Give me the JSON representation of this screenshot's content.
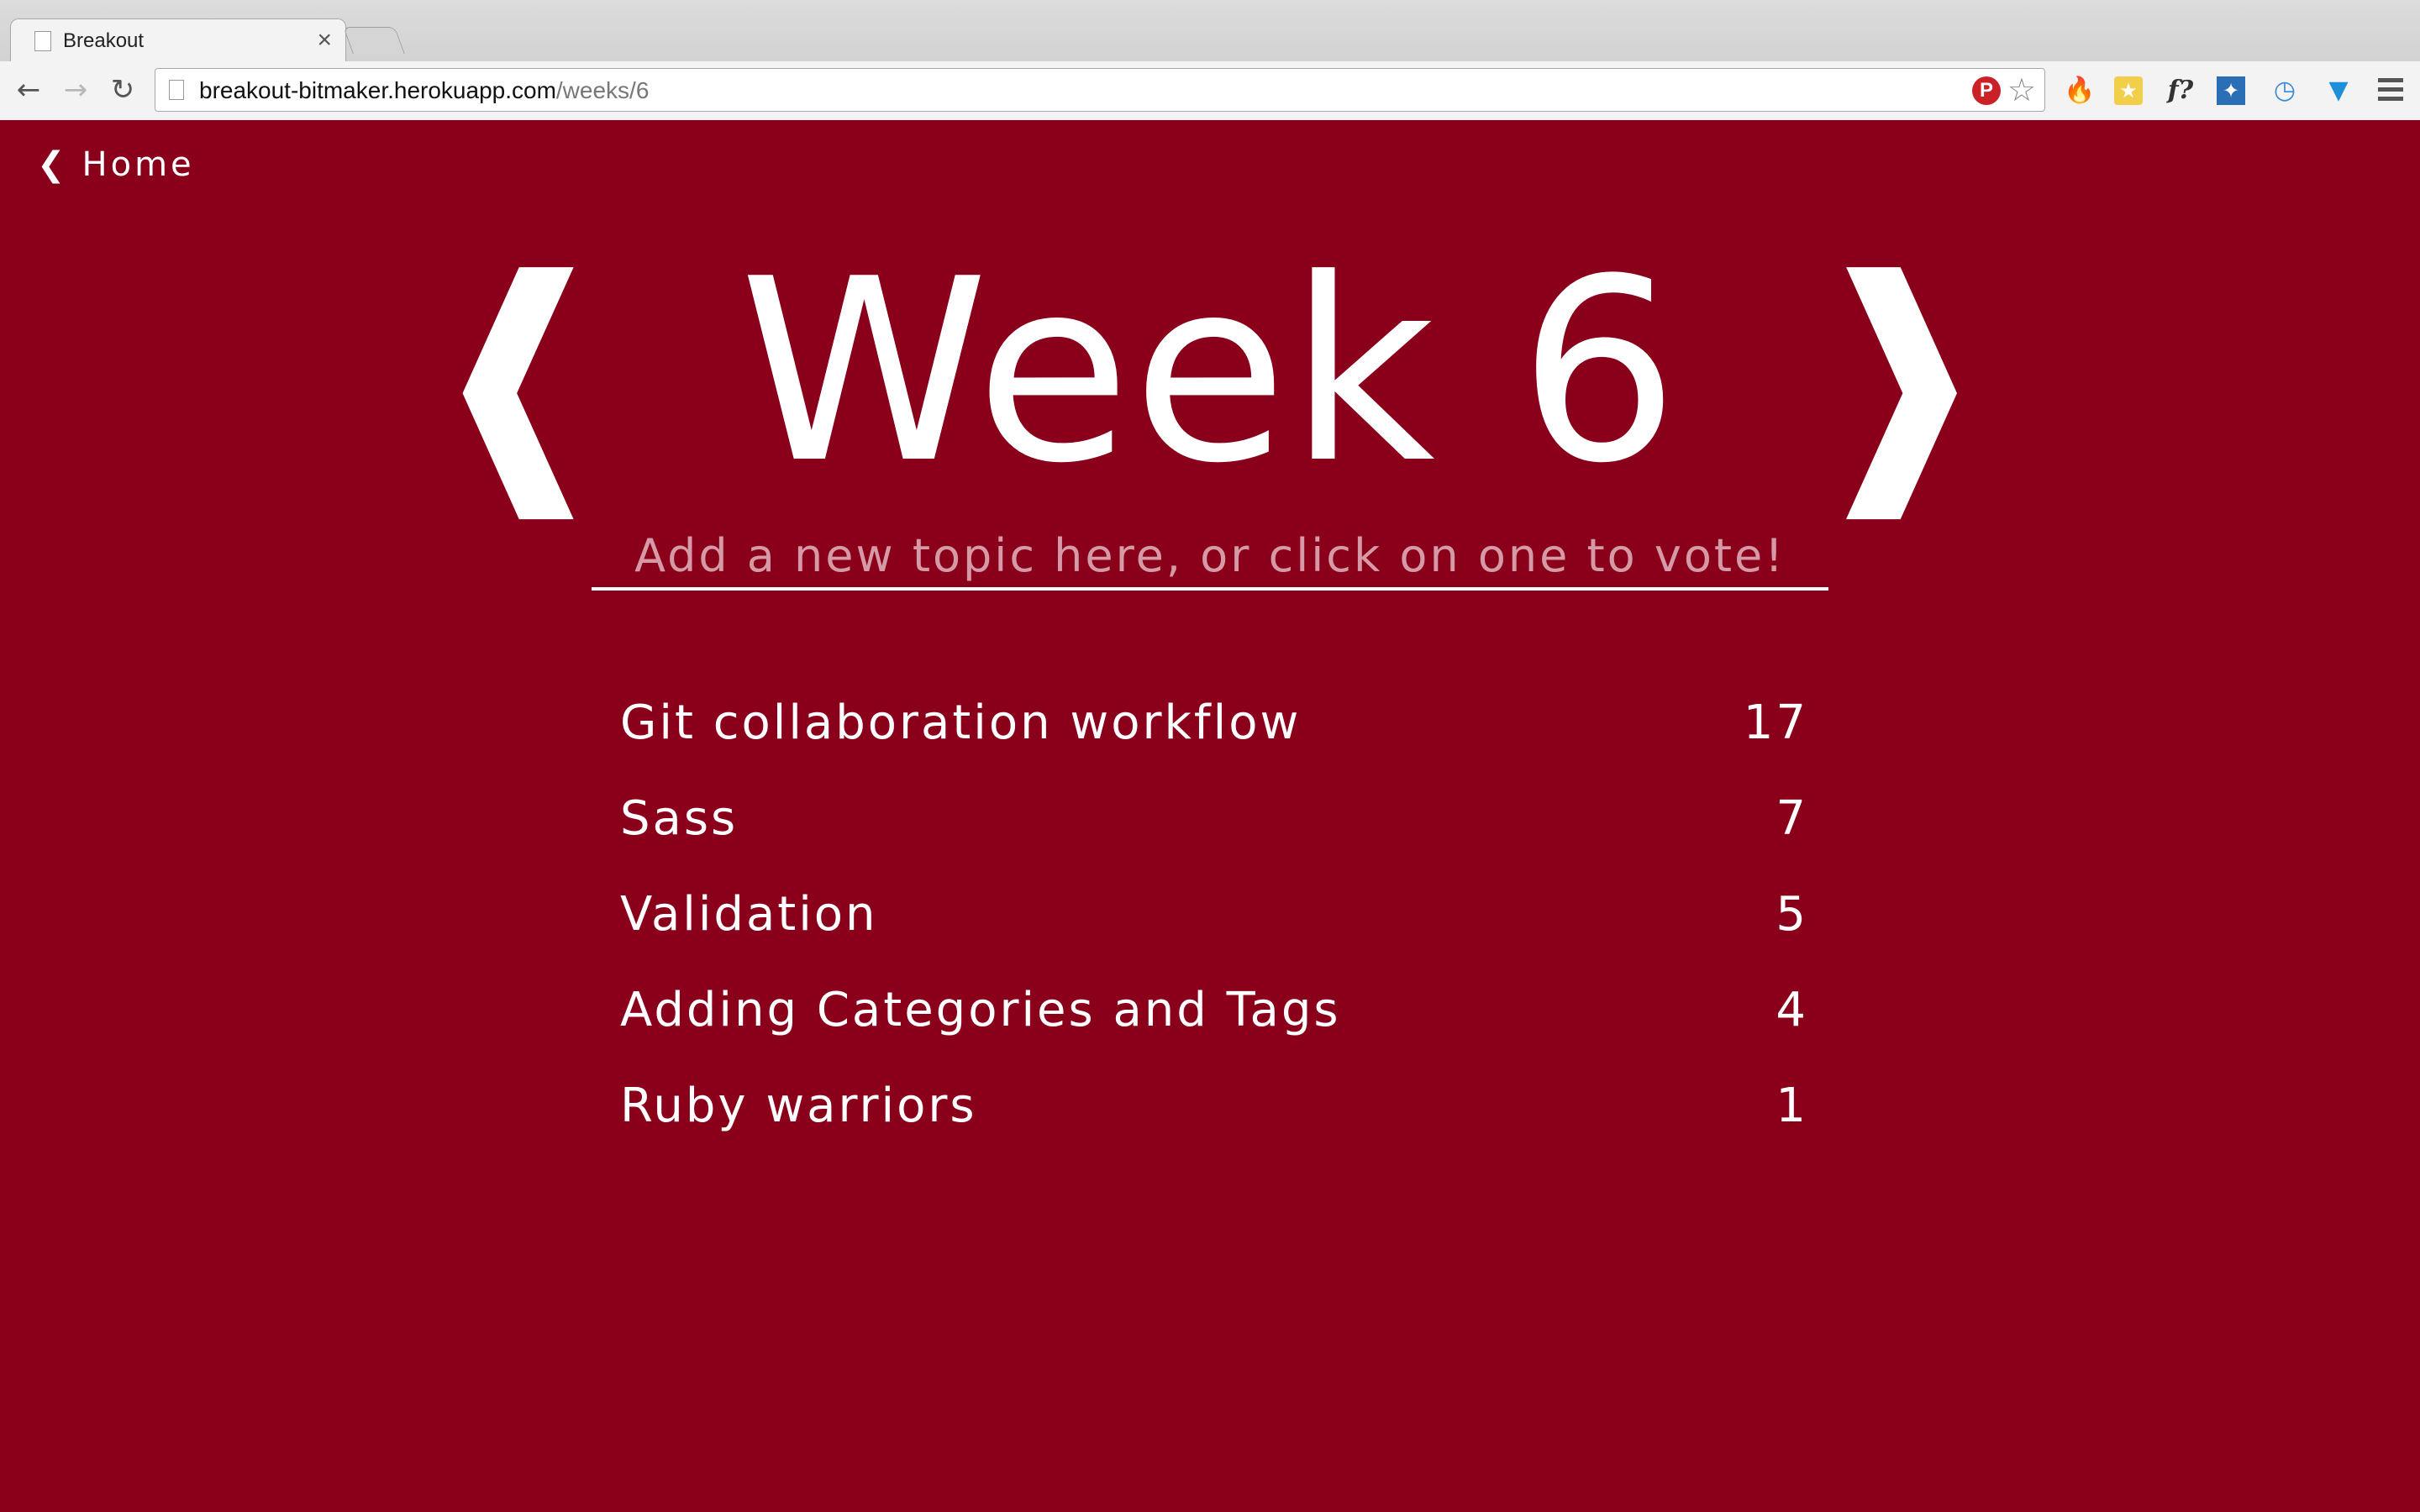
{
  "browser": {
    "tab_title": "Breakout",
    "tab_close_glyph": "×",
    "url_host": "breakout-bitmaker.herokuapp.com",
    "url_path": "/weeks/6",
    "nav": {
      "back_icon": "back-arrow-icon",
      "forward_icon": "forward-arrow-icon",
      "reload_icon": "reload-icon"
    },
    "extensions": [
      "pinterest-icon",
      "star-icon",
      "fire-extension-icon",
      "yellow-extension-icon",
      "font-extension-icon",
      "blue-extension-icon",
      "clock-extension-icon",
      "diamond-extension-icon",
      "menu-icon"
    ]
  },
  "page": {
    "background_color": "#8a001b",
    "text_color": "#ffffff",
    "home_link": {
      "chevron": "❮",
      "label": "Home"
    },
    "heading": {
      "prev_arrow": "❰",
      "title": "Week 6",
      "next_arrow": "❱"
    },
    "topic_input": {
      "placeholder": "Add a new topic here, or click on one to vote!",
      "value": ""
    },
    "topics": [
      {
        "name": "Git collaboration workflow",
        "votes": "17"
      },
      {
        "name": "Sass",
        "votes": "7"
      },
      {
        "name": "Validation",
        "votes": "5"
      },
      {
        "name": "Adding Categories and Tags",
        "votes": "4"
      },
      {
        "name": "Ruby warriors",
        "votes": "1"
      }
    ]
  }
}
